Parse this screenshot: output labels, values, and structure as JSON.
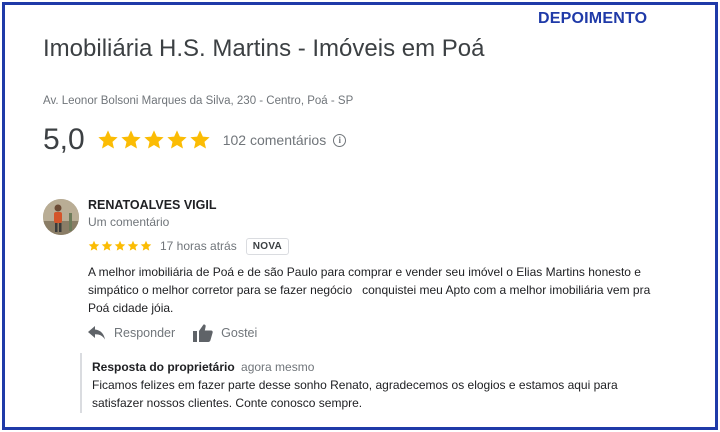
{
  "tag": "DEPOIMENTO",
  "business": {
    "name": "Imobiliária H.S. Martins - Imóveis em Poá",
    "address": "Av. Leonor Bolsoni Marques da Silva, 230 - Centro, Poá - SP",
    "rating": "5,0",
    "stars": 5,
    "reviews_label": "102 comentários",
    "info_icon": "info-icon",
    "star_color": "#fbbc04"
  },
  "review": {
    "reviewer_name": "RENATOALVES VIGIL",
    "reviewer_meta": "Um comentário",
    "stars": 5,
    "time": "17 horas atrás",
    "badge": "NOVA",
    "text": "A melhor imobiliária de Poá e de são Paulo para comprar e vender seu imóvel o Elias Martins honesto e simpático o melhor corretor para se fazer negócio   conquistei meu Apto com a melhor imobiliária vem pra Poá cidade jóia.",
    "actions": {
      "reply_label": "Responder",
      "reply_icon": "reply-arrow-icon",
      "like_label": "Gostei",
      "like_icon": "thumbs-up-icon"
    }
  },
  "owner_reply": {
    "label": "Resposta do proprietário",
    "time": "agora mesmo",
    "text": "Ficamos felizes em fazer parte desse sonho Renato, agradecemos os elogios e estamos aqui para satisfazer nossos clientes. Conte conosco sempre."
  },
  "colors": {
    "frame": "#1f3aa8",
    "muted_text": "#70757a"
  }
}
